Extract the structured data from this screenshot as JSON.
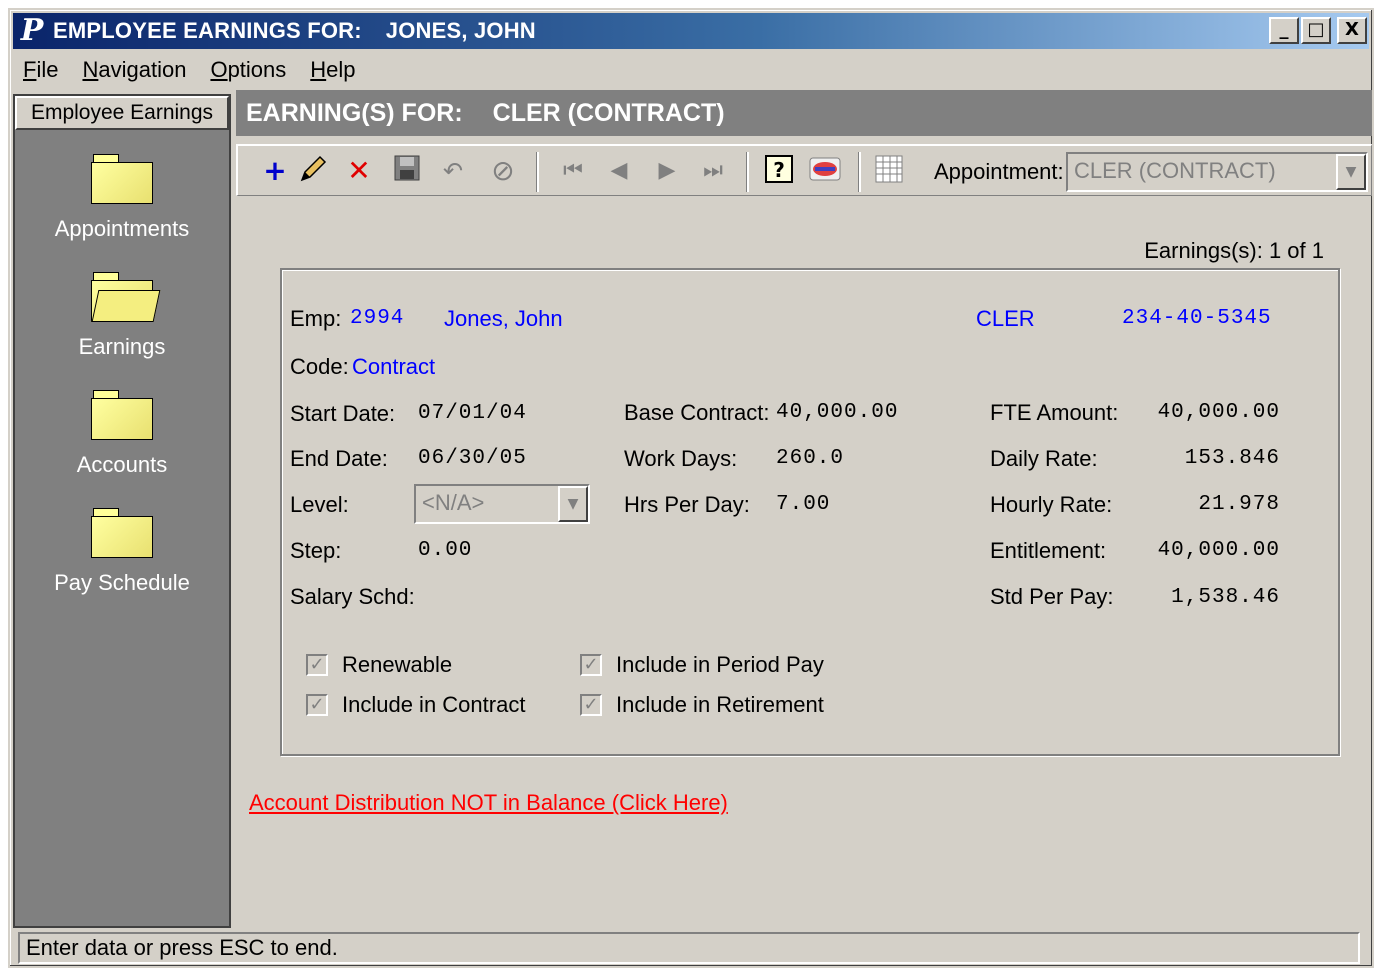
{
  "window": {
    "app_logo": "P",
    "title_prefix": "EMPLOYEE EARNINGS FOR:",
    "title_employee": "JONES, JOHN",
    "controls": {
      "minimize": "_",
      "maximize": "□",
      "close": "X"
    }
  },
  "menu": [
    {
      "key": "F",
      "rest": "ile"
    },
    {
      "key": "N",
      "rest": "avigation"
    },
    {
      "key": "O",
      "rest": "ptions"
    },
    {
      "key": "H",
      "rest": "elp"
    }
  ],
  "sidebar": {
    "header": "Employee Earnings",
    "items": [
      {
        "label": "Appointments",
        "icon": "folder-icon"
      },
      {
        "label": "Earnings",
        "icon": "open-folder-icon"
      },
      {
        "label": "Accounts",
        "icon": "folder-icon"
      },
      {
        "label": "Pay Schedule",
        "icon": "folder-icon"
      }
    ]
  },
  "main": {
    "header_label": "EARNING(S) FOR:",
    "header_code": "CLER  (CONTRACT)"
  },
  "toolbar": {
    "icons": [
      "add-icon",
      "edit-icon",
      "delete-icon",
      "save-icon",
      "undo-icon",
      "cancel-icon",
      "first-record-icon",
      "previous-record-icon",
      "next-record-icon",
      "last-record-icon",
      "help-icon",
      "calculator-icon",
      "grid-icon"
    ],
    "appointment_label": "Appointment:",
    "appointment_value": "CLER  (CONTRACT)"
  },
  "record_count": "Earnings(s): 1 of 1",
  "form": {
    "emp_label": "Emp:",
    "emp_id": "2994",
    "emp_name": "Jones, John",
    "position": "CLER",
    "ssn": "234-40-5345",
    "code_label": "Code:",
    "code_value": "Contract",
    "start_date_label": "Start Date:",
    "start_date": "07/01/04",
    "end_date_label": "End Date:",
    "end_date": "06/30/05",
    "level_label": "Level:",
    "level_value": "<N/A>",
    "step_label": "Step:",
    "step_value": "0.00",
    "salary_schd_label": "Salary Schd:",
    "base_contract_label": "Base Contract:",
    "base_contract": "40,000.00",
    "work_days_label": "Work Days:",
    "work_days": "260.0",
    "hrs_per_day_label": "Hrs Per Day:",
    "hrs_per_day": "7.00",
    "fte_amount_label": "FTE Amount:",
    "fte_amount": "40,000.00",
    "daily_rate_label": "Daily Rate:",
    "daily_rate": "153.846",
    "hourly_rate_label": "Hourly Rate:",
    "hourly_rate": "21.978",
    "entitlement_label": "Entitlement:",
    "entitlement": "40,000.00",
    "std_per_pay_label": "Std Per Pay:",
    "std_per_pay": "1,538.46"
  },
  "checkboxes": {
    "renewable": "Renewable",
    "include_contract": "Include in Contract",
    "include_period_pay": "Include in Period Pay",
    "include_retirement": "Include in Retirement",
    "check_glyph": "✓"
  },
  "warning_link": "Account Distribution NOT in Balance (Click Here)",
  "status": "Enter data or press ESC to end.",
  "colors": {
    "title_start": "#0a246a",
    "link_blue": "#0000ff",
    "warning_red": "#ff0000",
    "face": "#d4d0c8"
  }
}
